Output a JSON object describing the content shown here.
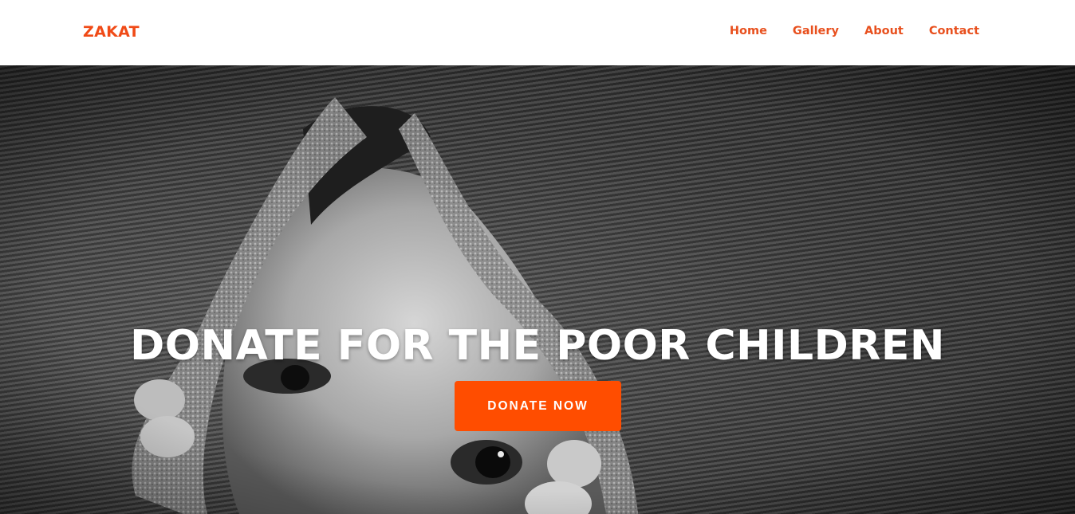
{
  "header": {
    "brand": "ZAKAT",
    "nav": [
      {
        "label": "Home"
      },
      {
        "label": "Gallery"
      },
      {
        "label": "About"
      },
      {
        "label": "Contact"
      }
    ]
  },
  "hero": {
    "title": "DONATE FOR THE POOR CHILDREN",
    "cta_label": "DONATE NOW",
    "image_subject": "child-peeking-through-torn-knit-fabric"
  },
  "colors": {
    "brand": "#f04a16",
    "nav": "#e8501e",
    "cta": "#ff4d00",
    "header_bg": "#ffffff"
  }
}
